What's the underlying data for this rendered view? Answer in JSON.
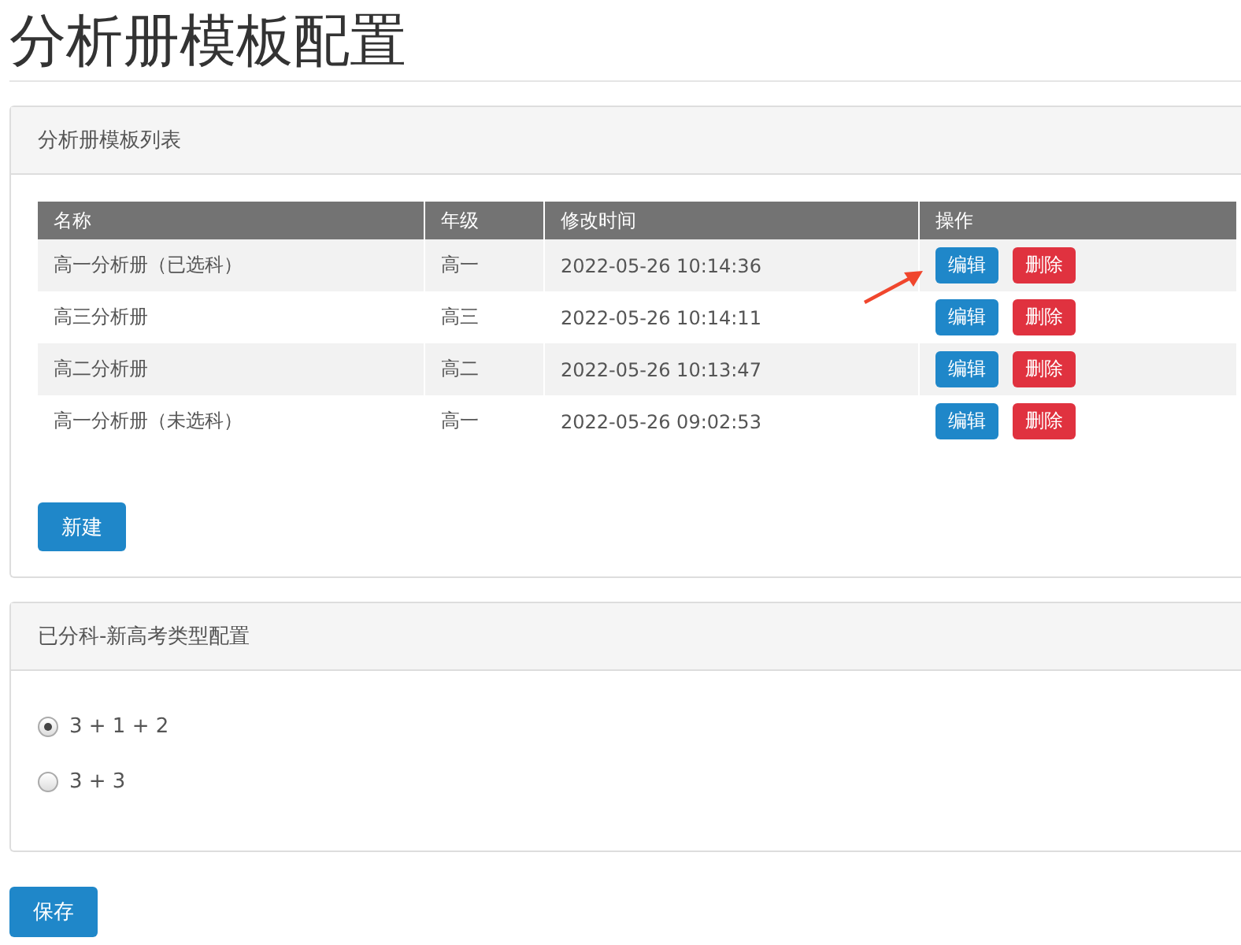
{
  "page_title": "分析册模板配置",
  "template_panel": {
    "title": "分析册模板列表",
    "table": {
      "columns": [
        "名称",
        "年级",
        "修改时间",
        "操作"
      ],
      "rows": [
        {
          "name": "高一分析册（已选科）",
          "grade": "高一",
          "modified": "2022-05-26 10:14:36",
          "actions": [
            "编辑",
            "删除"
          ]
        },
        {
          "name": "高三分析册",
          "grade": "高三",
          "modified": "2022-05-26 10:14:11",
          "actions": [
            "编辑",
            "删除"
          ]
        },
        {
          "name": "高二分析册",
          "grade": "高二",
          "modified": "2022-05-26 10:13:47",
          "actions": [
            "编辑",
            "删除"
          ]
        },
        {
          "name": "高一分析册（未选科）",
          "grade": "高一",
          "modified": "2022-05-26 09:02:53",
          "actions": [
            "编辑",
            "删除"
          ]
        }
      ]
    },
    "new_button": "新建"
  },
  "exam_type_panel": {
    "title": "已分科-新高考类型配置",
    "options": [
      {
        "label": "3 + 1 + 2",
        "selected": true
      },
      {
        "label": "3 + 3",
        "selected": false
      }
    ]
  },
  "save_button": "保存"
}
